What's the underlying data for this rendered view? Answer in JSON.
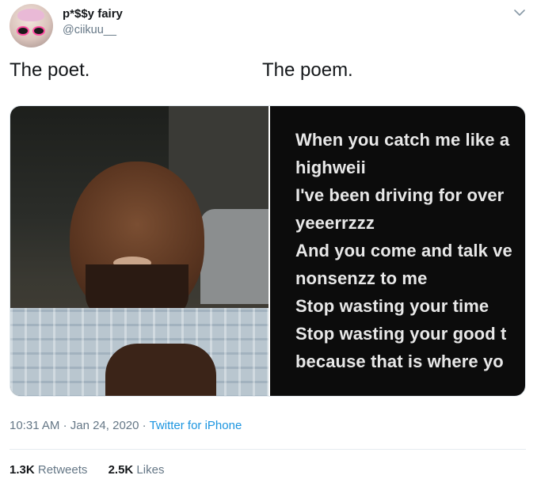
{
  "tweet": {
    "author": {
      "display_name": "p*$$y fairy",
      "handle": "@ciikuu__"
    },
    "captions": {
      "left": "The poet.",
      "right": "The poem."
    },
    "poem_lines": [
      "When you catch me like a",
      "highweii",
      "I've been driving for over",
      "yeeerrzzz",
      "And you come and talk ve",
      "nonsenzz to me",
      "Stop wasting your time",
      "Stop wasting your good t",
      "because that is where yo"
    ],
    "timestamp": {
      "time": "10:31 AM",
      "date": "Jan 24, 2020",
      "source": "Twitter for iPhone"
    },
    "stats": {
      "retweets_count": "1.3K",
      "retweets_label": "Retweets",
      "likes_count": "2.5K",
      "likes_label": "Likes"
    }
  },
  "icons": {
    "menu": "chevron-down-icon"
  },
  "colors": {
    "link": "#1b95e0",
    "secondary_text": "#657786",
    "primary_text": "#14171a"
  }
}
